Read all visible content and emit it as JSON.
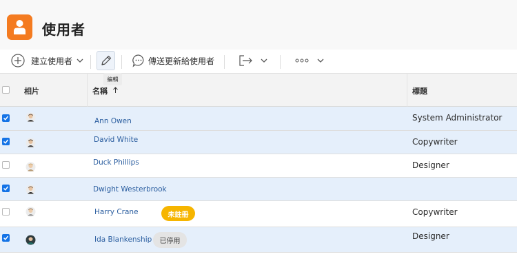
{
  "header": {
    "title": "使用者",
    "icon": "user-icon",
    "icon_color": "#f47b20"
  },
  "toolbar": {
    "add_user_label": "建立使用者",
    "edit_tooltip": "編輯",
    "send_update_label": "傳送更新給使用者"
  },
  "table": {
    "columns": {
      "photo": "相片",
      "name": "名稱",
      "title": "標題"
    },
    "sort": {
      "column": "name",
      "direction": "ascending"
    },
    "rows": [
      {
        "selected": true,
        "name": "Ann Owen",
        "title": "System Administrator",
        "badge": ""
      },
      {
        "selected": true,
        "name": "David White",
        "title": "Copywriter",
        "badge": ""
      },
      {
        "selected": false,
        "name": "Duck Phillips",
        "title": "Designer",
        "badge": ""
      },
      {
        "selected": true,
        "name": "Dwight Westerbrook",
        "title": "",
        "badge": ""
      },
      {
        "selected": false,
        "name": "Harry Crane",
        "title": "Copywriter",
        "badge": "未註冊"
      },
      {
        "selected": true,
        "name": "Ida Blankenship",
        "title": "Designer",
        "badge": "已停用"
      }
    ]
  },
  "colors": {
    "accent": "#1473e6",
    "selected_row": "#e5effb",
    "link": "#2a5d9f",
    "unregistered_badge": "#f6b500"
  }
}
